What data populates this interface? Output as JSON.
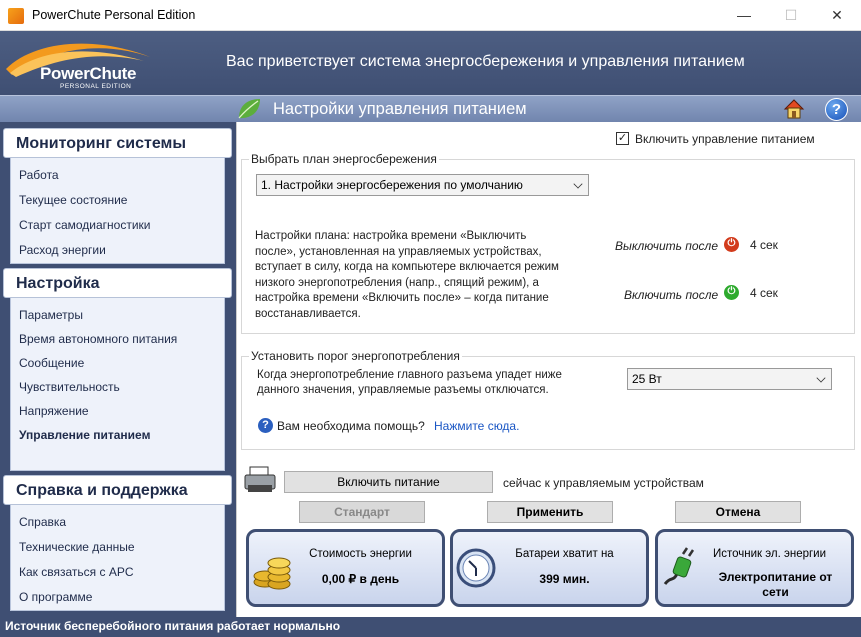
{
  "window": {
    "title": "PowerChute Personal Edition",
    "minimize": "—",
    "maximize": "☐",
    "close": "✕"
  },
  "header": {
    "logo_text": "PowerChute",
    "logo_sub": "PERSONAL EDITION",
    "welcome": "Вас приветствует система энергосбережения и управления питанием"
  },
  "subheader": {
    "title": "Настройки управления питанием",
    "help_icon": "?"
  },
  "sidebar": {
    "monitoring": {
      "title": "Мониторинг системы",
      "items": [
        "Работа",
        "Текущее состояние",
        "Старт самодиагностики",
        "Расход энергии"
      ]
    },
    "settings": {
      "title": "Настройка",
      "items": [
        "Параметры",
        "Время автономного питания",
        "Сообщение",
        "Чувствительность",
        "Напряжение",
        "Управление питанием"
      ]
    },
    "support": {
      "title": "Справка и поддержка",
      "items": [
        "Справка",
        "Технические данные",
        "Как связаться с APC",
        "О программе"
      ]
    }
  },
  "main": {
    "enable_checkbox_label": "Включить управление питанием",
    "enable_checked": true,
    "plan_group_label": "Выбрать план энергосбережения",
    "plan_select_value": "1. Настройки энергосбережения по умолчанию",
    "plan_description": "Настройки плана: настройка времени «Выключить после», установленная на управляемых устройствах, вступает в силу, когда на компьютере включается режим низкого энергопотребления (напр., спящий режим), а настройка времени «Включить после» – когда питание восстанавливается.",
    "off_after_label": "Выключить после",
    "off_after_value": "4 сек",
    "on_after_label": "Включить после",
    "on_after_value": "4 сек",
    "threshold_group_label": "Установить порог энергопотребления",
    "threshold_text": "Когда энергопотребление главного разъема упадет ниже данного значения, управляемые разъемы отключатся.",
    "threshold_select_value": "25 Вт",
    "help_question": "Вам необходима помощь?",
    "help_link": "Нажмите сюда.",
    "enable_power_button": "Включить питание",
    "enable_power_suffix": "сейчас к управляемым устройствам",
    "buttons": {
      "standard": "Стандарт",
      "apply": "Применить",
      "cancel": "Отмена"
    }
  },
  "cards": [
    {
      "title": "Стоимость энергии",
      "value": "0,00 ₽ в день",
      "icon": "coins-icon"
    },
    {
      "title": "Батареи хватит на",
      "value": "399 мин.",
      "icon": "clock-icon"
    },
    {
      "title": "Источник эл. энергии",
      "value": "Электропитание от сети",
      "icon": "plug-icon"
    }
  ],
  "status": {
    "text": "Источник бесперебойного питания работает нормально"
  },
  "colors": {
    "header": "#3f4f73",
    "subheader": "#7f92bb",
    "accent_link": "#1a56c4",
    "power_off": "#d23b1c",
    "power_on": "#2eaa2e"
  }
}
